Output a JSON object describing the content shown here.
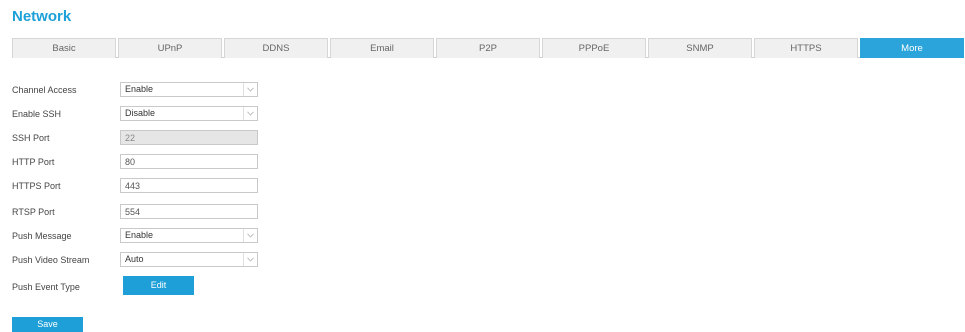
{
  "page": {
    "title": "Network"
  },
  "tabs": [
    {
      "label": "Basic"
    },
    {
      "label": "UPnP"
    },
    {
      "label": "DDNS"
    },
    {
      "label": "Email"
    },
    {
      "label": "P2P"
    },
    {
      "label": "PPPoE"
    },
    {
      "label": "SNMP"
    },
    {
      "label": "HTTPS"
    },
    {
      "label": "More",
      "active": true
    }
  ],
  "form": {
    "channel_access": {
      "label": "Channel Access",
      "value": "Enable"
    },
    "enable_ssh": {
      "label": "Enable SSH",
      "value": "Disable"
    },
    "ssh_port": {
      "label": "SSH Port",
      "value": "22"
    },
    "http_port": {
      "label": "HTTP Port",
      "value": "80"
    },
    "https_port": {
      "label": "HTTPS Port",
      "value": "443"
    },
    "rtsp_port": {
      "label": "RTSP Port",
      "value": "554"
    },
    "push_message": {
      "label": "Push Message",
      "value": "Enable"
    },
    "push_video_stream": {
      "label": "Push Video Stream",
      "value": "Auto"
    },
    "push_event_type": {
      "label": "Push Event Type",
      "button": "Edit"
    }
  },
  "actions": {
    "save_label": "Save"
  },
  "colors": {
    "accent": "#1ea0d8",
    "active_tab": "#2aa4db"
  }
}
